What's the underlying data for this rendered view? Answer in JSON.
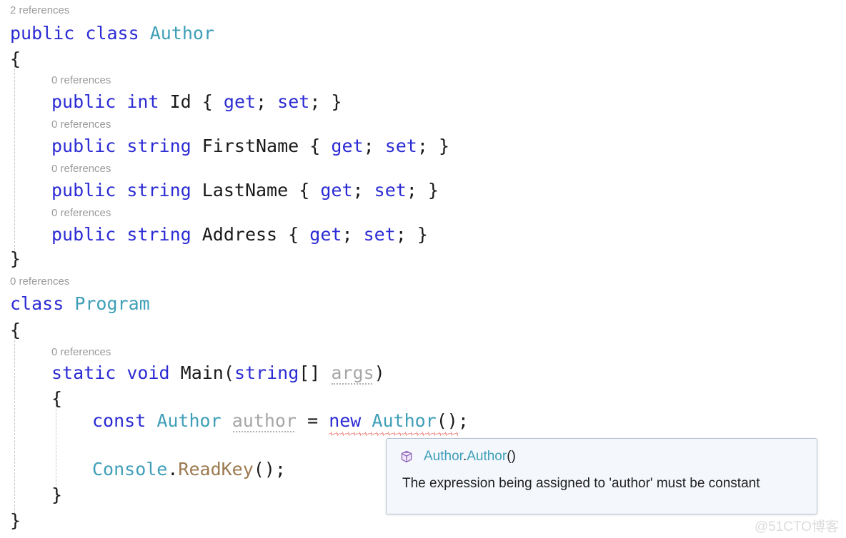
{
  "editor": {
    "language": "csharp",
    "background": "#ffffff",
    "colors": {
      "keyword": "#2b2bd4",
      "type": "#3f9fb8",
      "identifier": "#1a1a1a",
      "method": "#9c7a50",
      "unused": "#a6a6a6",
      "codelens": "#9a9a9a",
      "error_squiggle": "#e8544a",
      "indent_guide": "#c8c8c8"
    },
    "codelens": {
      "class_author": "2 references",
      "prop_id": "0 references",
      "prop_firstname": "0 references",
      "prop_lastname": "0 references",
      "prop_address": "0 references",
      "class_program": "0 references",
      "method_main": "0 references"
    },
    "lines": {
      "l1": {
        "kw1": "public",
        "kw2": "class",
        "type": "Author"
      },
      "l2": {
        "brace": "{"
      },
      "l3": {
        "kw1": "public",
        "kw2": "int",
        "name": "Id",
        "open": "{",
        "get": "get",
        "semi1": ";",
        "set": "set",
        "semi2": ";",
        "close": "}"
      },
      "l4": {
        "kw1": "public",
        "kw2": "string",
        "name": "FirstName",
        "open": "{",
        "get": "get",
        "semi1": ";",
        "set": "set",
        "semi2": ";",
        "close": "}"
      },
      "l5": {
        "kw1": "public",
        "kw2": "string",
        "name": "LastName",
        "open": "{",
        "get": "get",
        "semi1": ";",
        "set": "set",
        "semi2": ";",
        "close": "}"
      },
      "l6": {
        "kw1": "public",
        "kw2": "string",
        "name": "Address",
        "open": "{",
        "get": "get",
        "semi1": ";",
        "set": "set",
        "semi2": ";",
        "close": "}"
      },
      "l7": {
        "brace": "}"
      },
      "l8": {
        "kw1": "class",
        "type": "Program"
      },
      "l9": {
        "brace": "{"
      },
      "l10": {
        "kw1": "static",
        "kw2": "void",
        "name": "Main",
        "paren_open": "(",
        "kw3": "string",
        "brackets": "[]",
        "arg": "args",
        "paren_close": ")"
      },
      "l11": {
        "brace": "{"
      },
      "l12": {
        "kw1": "const",
        "type1": "Author",
        "var": "author",
        "eq": "=",
        "kw2": "new",
        "type2": "Author",
        "call": "()",
        "semi": ";"
      },
      "l13": {
        "type": "Console",
        "dot": ".",
        "method": "ReadKey",
        "call": "()",
        "semi": ";"
      },
      "l14": {
        "brace": "}"
      },
      "l15": {
        "brace": "}"
      }
    }
  },
  "tooltip": {
    "icon": "method-cube-icon",
    "signature_type": "Author",
    "signature_dot": ".",
    "signature_member": "Author",
    "signature_params": "()",
    "message": "The expression being assigned to 'author' must be constant",
    "background": "#f4f7fc",
    "border": "#b9c4d4"
  },
  "watermark": {
    "text": "@51CTO博客"
  }
}
